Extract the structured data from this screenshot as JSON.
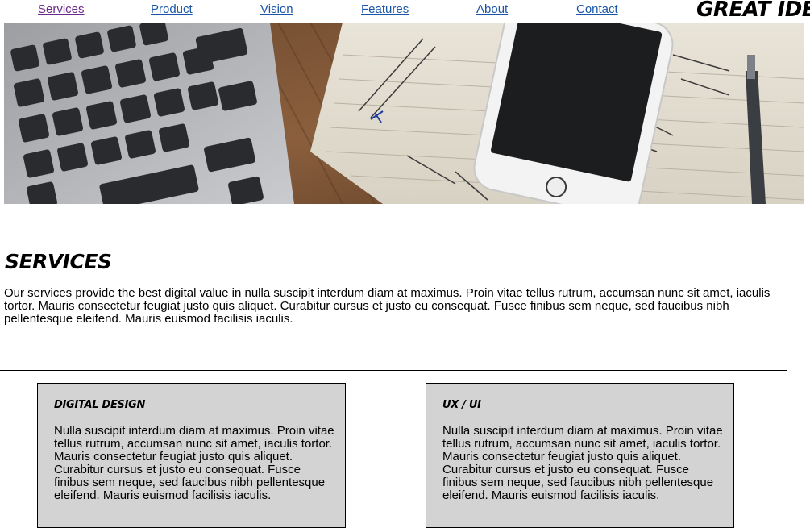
{
  "nav": {
    "links": [
      "Services",
      "Product",
      "Vision",
      "Features",
      "About",
      "Contact"
    ],
    "brand": "GREAT IDEA"
  },
  "hero": {
    "icon": "hero-desk-photo"
  },
  "services": {
    "heading": "Services",
    "intro": "Our services provide the best digital value in nulla suscipit interdum diam at maximus. Proin vitae tellus rutrum, accumsan nunc sit amet, iaculis tortor. Mauris consectetur feugiat justo quis aliquet. Curabitur cursus et justo eu consequat. Fusce finibus sem neque, sed faucibus nibh pellentesque eleifend. Mauris euismod facilisis iaculis."
  },
  "cards": [
    {
      "title": "Digital Design",
      "text": "Nulla suscipit interdum diam at maximus. Proin vitae tellus rutrum, accumsan nunc sit amet, iaculis tortor. Mauris consectetur feugiat justo quis aliquet. Curabitur cursus et justo eu consequat. Fusce finibus sem neque, sed faucibus nibh pellentesque eleifend. Mauris euismod facilisis iaculis."
    },
    {
      "title": "UX / UI",
      "text": "Nulla suscipit interdum diam at maximus. Proin vitae tellus rutrum, accumsan nunc sit amet, iaculis tortor. Mauris consectetur feugiat justo quis aliquet. Curabitur cursus et justo eu consequat. Fusce finibus sem neque, sed faucibus nibh pellentesque eleifend. Mauris euismod facilisis iaculis."
    }
  ],
  "colors": {
    "link": "#1a55aa",
    "link_visited": "#6b2a8a",
    "card_background": "#d3d3d3"
  }
}
